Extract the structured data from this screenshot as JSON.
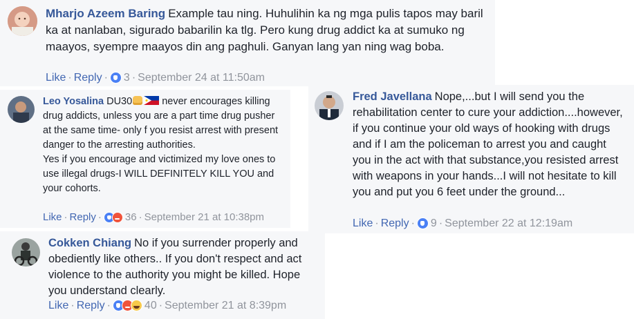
{
  "comments": [
    {
      "author": "Mharjo Azeem Baring",
      "text": "Example tau ning. Huhulihin ka ng mga pulis tapos may baril ka at nanlaban, sigurado babarilin ka tlg. Pero kung drug addict ka at sumuko ng maayos, syempre maayos din ang paghuli. Ganyan lang yan ning wag boba.",
      "like_label": "Like",
      "reply_label": "Reply",
      "reaction_count": "3",
      "timestamp": "September 24 at 11:50am",
      "reactions": [
        "like"
      ]
    },
    {
      "author": "Leo Yosalina",
      "text_prefix": "DU30",
      "text": "never encourages killing drug addicts, unless you are a part time drug pusher at the same time- only f you resist arrest with present danger to the arresting authorities.",
      "text_line2": "Yes if you encourage and victimized my love ones to use illegal drugs-I WILL DEFINITELY KILL YOU and your cohorts.",
      "like_label": "Like",
      "reply_label": "Reply",
      "reaction_count": "36",
      "timestamp": "September 21 at 10:38pm",
      "reactions": [
        "like",
        "angry"
      ]
    },
    {
      "author": "Fred Javellana",
      "text": "Nope,...but I will send you the rehabilitation center to cure your addiction....however, if you continue your old ways of hooking with drugs and if I am the policeman to arrest you and caught you in the act with that substance,you resisted arrest with weapons in your hands...I will not hesitate to kill you and put you 6 feet under the ground...",
      "like_label": "Like",
      "reply_label": "Reply",
      "reaction_count": "9",
      "timestamp": "September 22 at 12:19am",
      "reactions": [
        "like"
      ]
    },
    {
      "author": "Cokken Chiang",
      "text": "No if you surrender properly and obediently like others.. If you don't respect and act violence to the authority you might be killed. Hope you understand clearly.",
      "like_label": "Like",
      "reply_label": "Reply",
      "reaction_count": "40",
      "timestamp": "September 21 at 8:39pm",
      "reactions": [
        "like",
        "angry",
        "haha"
      ]
    }
  ],
  "colors": {
    "author": "#365899",
    "link": "#4267b2",
    "meta": "#90949c",
    "card_bg": "#f6f7f9"
  }
}
